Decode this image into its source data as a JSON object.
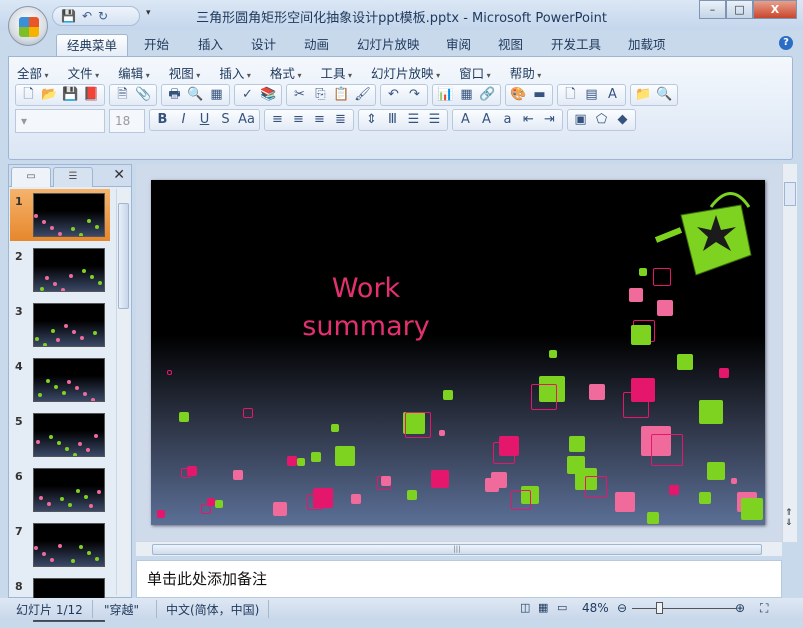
{
  "window": {
    "title": "三角形圆角矩形空间化抽象设计ppt模板.pptx - Microsoft PowerPoint",
    "minimize": "–",
    "restore": "□",
    "close": "X"
  },
  "ribbon_tabs": [
    "经典菜单",
    "开始",
    "插入",
    "设计",
    "动画",
    "幻灯片放映",
    "审阅",
    "视图",
    "开发工具",
    "加载项"
  ],
  "classic_menus": [
    "全部",
    "文件",
    "编辑",
    "视图",
    "插入",
    "格式",
    "工具",
    "幻灯片放映",
    "窗口",
    "帮助"
  ],
  "font_size": "18",
  "slides": {
    "count": 8,
    "numbers": [
      "1",
      "2",
      "3",
      "4",
      "5",
      "6",
      "7",
      "8"
    ],
    "selected": 1
  },
  "slide": {
    "title_line1": "Work",
    "title_line2": "summary",
    "accent": "#e4306f"
  },
  "notes_placeholder": "单击此处添加备注",
  "status": {
    "slide": "幻灯片 1/12",
    "theme": "\"穿越\"",
    "language": "中文(简体，中国)",
    "zoom": "48%",
    "zoom_percent": 48
  },
  "colors": {
    "green": "#7ed321",
    "pink": "#f06a9c",
    "magenta": "#e5176d",
    "background": "#000000"
  }
}
